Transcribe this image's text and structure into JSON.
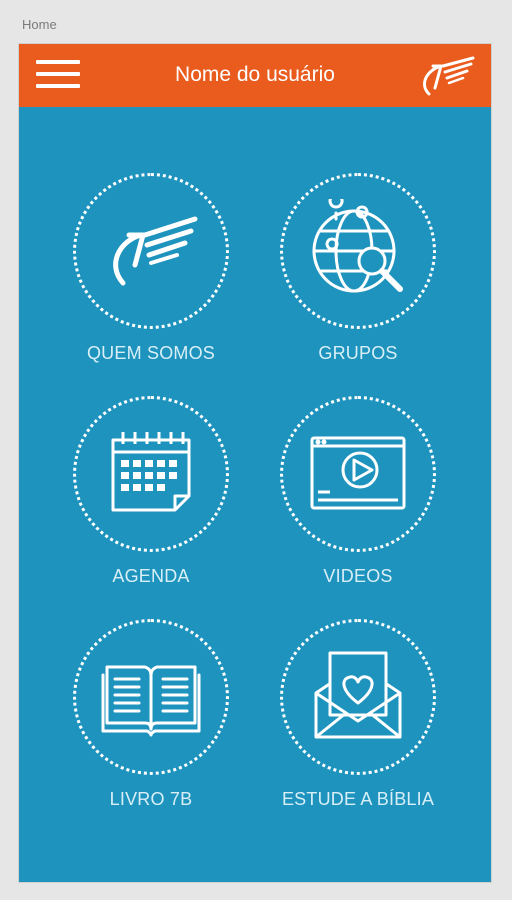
{
  "breadcrumb": "Home",
  "header": {
    "title": "Nome do usuário"
  },
  "colors": {
    "accent": "#ea5b1e",
    "background": "#1e93bd"
  },
  "tiles": [
    {
      "label": "QUEM SOMOS",
      "icon": "brand-logo-icon"
    },
    {
      "label": "GRUPOS",
      "icon": "globe-search-icon"
    },
    {
      "label": "AGENDA",
      "icon": "calendar-icon"
    },
    {
      "label": "VIDEOS",
      "icon": "video-player-icon"
    },
    {
      "label": "LIVRO 7B",
      "icon": "open-book-icon"
    },
    {
      "label": "ESTUDE A BÍBLIA",
      "icon": "heart-envelope-icon"
    }
  ]
}
